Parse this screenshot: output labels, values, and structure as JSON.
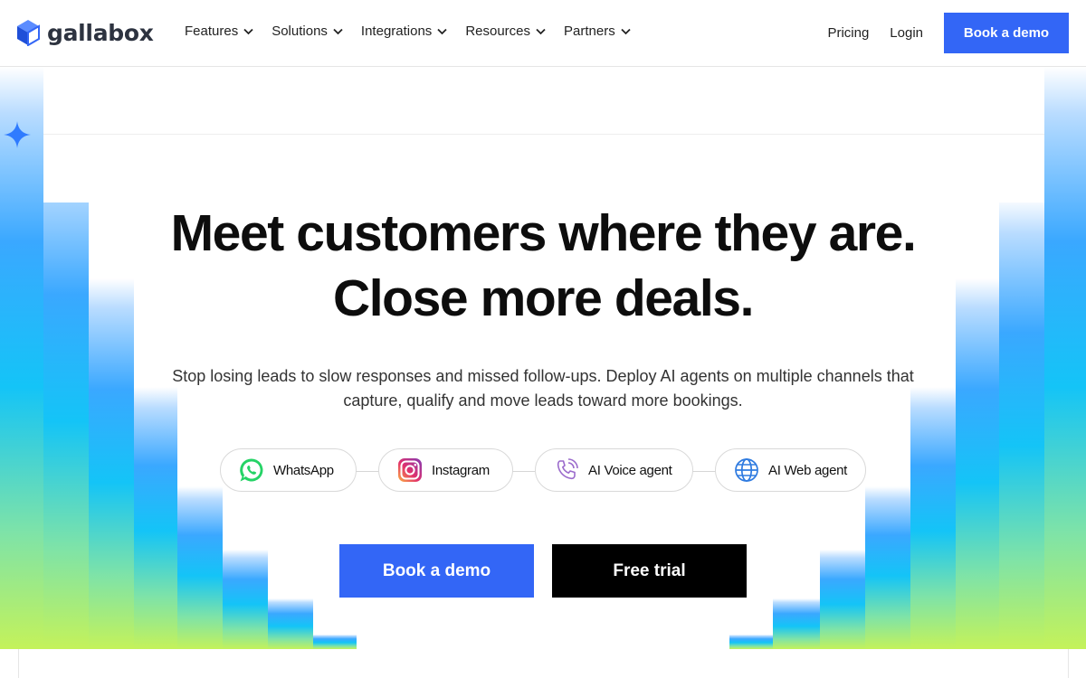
{
  "nav": {
    "brand": "gallabox",
    "menu": [
      {
        "label": "Features"
      },
      {
        "label": "Solutions"
      },
      {
        "label": "Integrations"
      },
      {
        "label": "Resources"
      },
      {
        "label": "Partners"
      }
    ],
    "pricing_label": "Pricing",
    "login_label": "Login",
    "book_demo_label": "Book a demo"
  },
  "hero": {
    "headline": "Meet customers where they are. Close more deals.",
    "subheadline": "Stop losing leads to slow responses and missed follow-ups. Deploy AI agents on multiple channels that capture, qualify and move leads toward more bookings.",
    "channels": [
      {
        "label": "WhatsApp",
        "icon": "whatsapp-icon"
      },
      {
        "label": "Instagram",
        "icon": "instagram-icon"
      },
      {
        "label": "AI Voice agent",
        "icon": "phone-call-icon"
      },
      {
        "label": "AI Web agent",
        "icon": "globe-icon"
      }
    ],
    "primary_cta": "Book a demo",
    "secondary_cta": "Free trial"
  },
  "colors": {
    "accent_blue": "#3366f6",
    "black": "#000000",
    "whatsapp_green": "#25d366",
    "gradient_cyan": "#14c4f7",
    "gradient_lime": "#c4f25a"
  }
}
